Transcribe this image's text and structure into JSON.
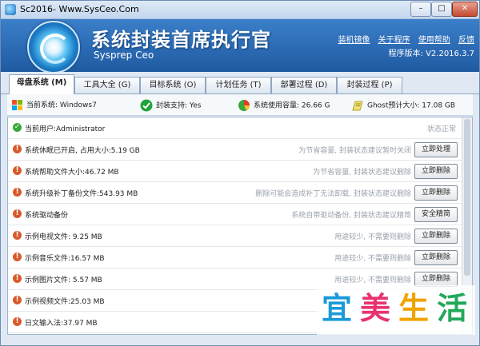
{
  "window": {
    "title": "Sc2016- Www.SysCeo.Com"
  },
  "banner": {
    "title": "系统封装首席执行官",
    "subtitle": "Sysprep Ceo",
    "links": [
      "装机镜像",
      "关于程序",
      "使用帮助",
      "反馈"
    ],
    "version": "程序版本: V2.2016.3.7"
  },
  "tabs": [
    {
      "label": "母盘系统 (M)",
      "active": true
    },
    {
      "label": "工具大全 (G)"
    },
    {
      "label": "目标系统 (O)"
    },
    {
      "label": "计划任务 (T)"
    },
    {
      "label": "部署过程 (D)"
    },
    {
      "label": "封装过程 (P)"
    }
  ],
  "summary": {
    "current_system": "当前系统: Windows7",
    "pack_support": "封装支持: Yes",
    "system_used": "系统使用容量: 26.66 G",
    "ghost_estimate": "Ghost预计大小: 17.08 GB"
  },
  "rows": [
    {
      "status": "ok",
      "label": "当前用户:Administrator",
      "note": "状态正常",
      "action": ""
    },
    {
      "status": "warn",
      "label": "系统休眠已开启, 占用大小:5.19 GB",
      "note": "为节省容量, 封装状态建议暂时关闭",
      "action": "立即处理"
    },
    {
      "status": "warn",
      "label": "系统帮助文件大小:46.72 MB",
      "note": "为节省容量, 封装状态建议删除",
      "action": "立即删除"
    },
    {
      "status": "warn",
      "label": "系统升级补丁备份文件:543.93 MB",
      "note": "删除可能会造成补丁无法卸载, 封装状态建议删除",
      "action": "立即删除"
    },
    {
      "status": "warn",
      "label": "系统驱动备份",
      "note": "系统自带驱动备份, 封装状态建议精简",
      "action": "安全精简"
    },
    {
      "status": "warn",
      "label": "示例电视文件: 9.25 MB",
      "note": "用途较少, 不需要则删除",
      "action": "立即删除"
    },
    {
      "status": "warn",
      "label": "示例音乐文件:16.57 MB",
      "note": "用途较少, 不需要则删除",
      "action": "立即删除"
    },
    {
      "status": "warn",
      "label": "示例图片文件: 5.57 MB",
      "note": "用途较少, 不需要则删除",
      "action": "立即删除"
    },
    {
      "status": "warn",
      "label": "示例视频文件:25.03 MB",
      "note": "",
      "action": ""
    },
    {
      "status": "warn",
      "label": "日文输入法:37.97 MB",
      "note": "",
      "action": ""
    }
  ],
  "watermark": {
    "chars": [
      "宜",
      "美",
      "生",
      "活"
    ],
    "colors": [
      "#1a9ad8",
      "#e8336f",
      "#f0a400",
      "#23a85a"
    ]
  }
}
